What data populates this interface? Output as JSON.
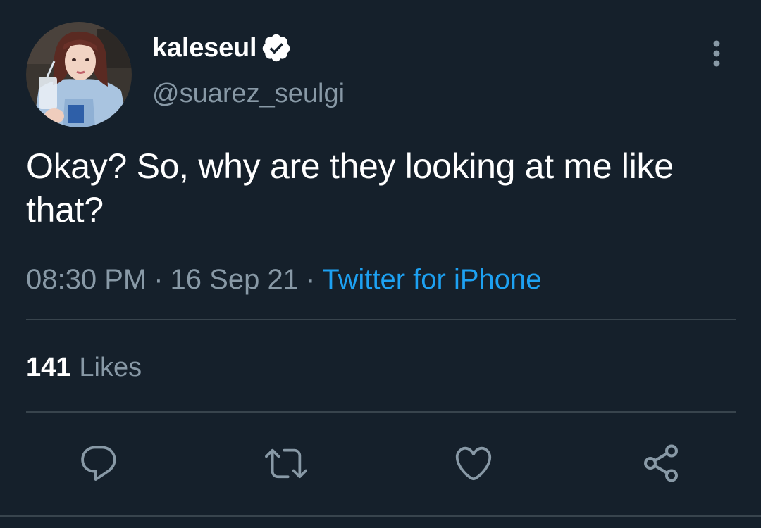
{
  "user": {
    "display_name": "kaleseul",
    "handle": "@suarez_seulgi",
    "verified": true
  },
  "tweet": {
    "text": "Okay? So, why are they looking at me like that?",
    "time": "08:30 PM",
    "date": "16 Sep 21",
    "separator": "·",
    "source": "Twitter for iPhone"
  },
  "stats": {
    "likes_count": "141",
    "likes_label": "Likes"
  },
  "actions": [
    "reply-icon",
    "retweet-icon",
    "like-icon",
    "share-icon"
  ],
  "colors": {
    "background": "#15202b",
    "text": "#ffffff",
    "secondary": "#8899a6",
    "accent": "#1da1f2",
    "divider": "#38444d"
  }
}
